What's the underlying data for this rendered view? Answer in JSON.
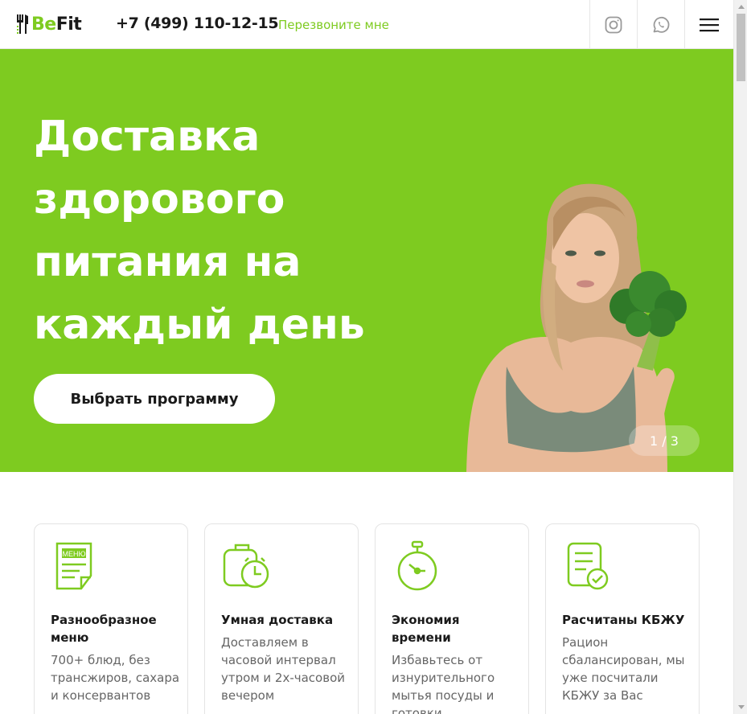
{
  "header": {
    "logo_be": "Be",
    "logo_fit": "Fit",
    "phone": "+7 (499) 110-12-15",
    "callback": "Перезвоните мне",
    "instagram_icon": "instagram-icon",
    "whatsapp_icon": "whatsapp-icon",
    "menu_icon": "hamburger-menu-icon"
  },
  "hero": {
    "title": "Доставка здорового питания на каждый день",
    "button": "Выбрать программу",
    "slide_counter": "1 / 3"
  },
  "features": [
    {
      "icon": "menu-document-icon",
      "icon_text": "МЕНЮ",
      "title": "Разнообразное меню",
      "desc": "700+ блюд, без трансжиров, сахара и консервантов"
    },
    {
      "icon": "bag-clock-icon",
      "title": "Умная доставка",
      "desc": "Доставляем в часовой интервал утром и 2х-часовой вечером"
    },
    {
      "icon": "stopwatch-icon",
      "title": "Экономия времени",
      "desc": "Избавьтесь от изнурительного мытья посуды и готовки"
    },
    {
      "icon": "checklist-icon",
      "title": "Расчитаны КБЖУ",
      "desc": "Рацион сбалансирован, мы уже посчитали КБЖУ за Вас"
    }
  ],
  "colors": {
    "accent": "#7ecb20",
    "text": "#1a1a1a",
    "muted": "#666666"
  }
}
